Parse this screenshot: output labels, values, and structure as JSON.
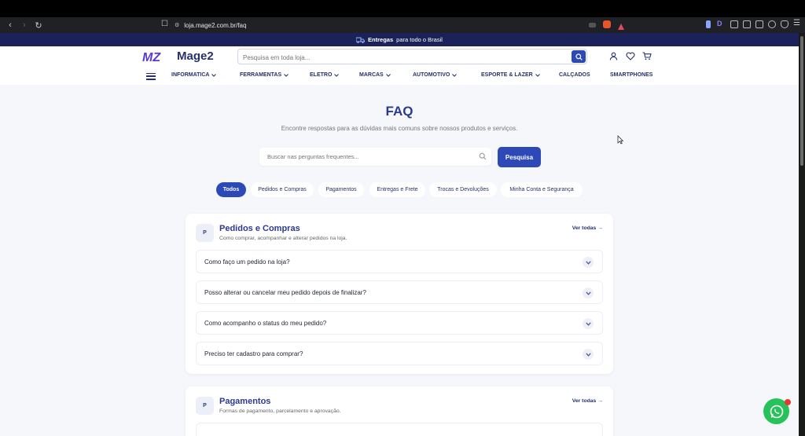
{
  "browser": {
    "url": "loja.mage2.com.br/faq"
  },
  "promo": {
    "bold": "Entregas",
    "rest": "para todo o Brasil"
  },
  "header": {
    "logo_mark": "MZ",
    "logo_text": "Mage2",
    "search_placeholder": "Pesquisa em toda loja..."
  },
  "menu": [
    {
      "label": "INFORMATICA",
      "dropdown": true
    },
    {
      "label": "FERRAMENTAS",
      "dropdown": true
    },
    {
      "label": "ELETRO",
      "dropdown": true
    },
    {
      "label": "MARCAS",
      "dropdown": true
    },
    {
      "label": "AUTOMOTIVO",
      "dropdown": true
    },
    {
      "label": "ESPORTE & LAZER",
      "dropdown": true
    },
    {
      "label": "CALÇADOS",
      "dropdown": false
    },
    {
      "label": "SMARTPHONES",
      "dropdown": false
    }
  ],
  "faq": {
    "title": "FAQ",
    "subtitle": "Encontre respostas para as dúvidas mais comuns sobre nossos produtos e serviços.",
    "search_placeholder": "Buscar nas perguntas frequentes...",
    "search_button": "Pesquisa"
  },
  "tabs": [
    {
      "label": "Todos",
      "active": true
    },
    {
      "label": "Pedidos e Compras",
      "active": false
    },
    {
      "label": "Pagamentos",
      "active": false
    },
    {
      "label": "Entregas e Frete",
      "active": false
    },
    {
      "label": "Trocas e Devoluções",
      "active": false
    },
    {
      "label": "Minha Conta e Segurança",
      "active": false
    }
  ],
  "sections": [
    {
      "badge": "P",
      "title": "Pedidos e Compras",
      "description": "Como comprar, acompanhar e alterar pedidos na loja.",
      "link": "Ver todas →",
      "questions": [
        "Como faço um pedido na loja?",
        "Posso alterar ou cancelar meu pedido depois de finalizar?",
        "Como acompanho o status do meu pedido?",
        "Preciso ter cadastro para comprar?"
      ]
    },
    {
      "badge": "P",
      "title": "Pagamentos",
      "description": "Formas de pagamento, parcelamento e aprovação.",
      "link": "Ver todas →",
      "questions": []
    }
  ],
  "colors": {
    "primary": "#2c49b7",
    "navy": "#26306b",
    "whatsapp": "#27c25a"
  }
}
